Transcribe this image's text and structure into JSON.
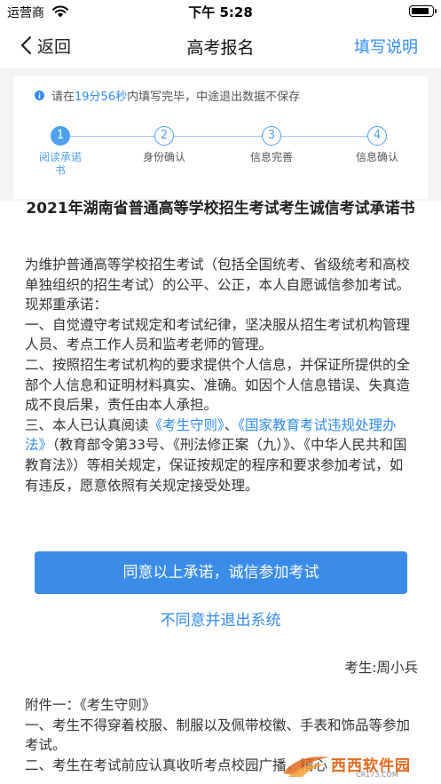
{
  "status_bar": {
    "carrier": "运营商",
    "time": "下午 5:28",
    "battery_level": 0.9
  },
  "nav": {
    "back_label": "返回",
    "title": "高考报名",
    "right_label": "填写说明"
  },
  "notice": {
    "prefix": "请在",
    "time_left": "19分56秒",
    "suffix": "内填写完毕，中途退出数据不保存"
  },
  "steps": [
    {
      "number": "1",
      "label": "阅读承诺书",
      "active": true
    },
    {
      "number": "2",
      "label": "身份确认",
      "active": false
    },
    {
      "number": "3",
      "label": "信息完善",
      "active": false
    },
    {
      "number": "4",
      "label": "信息确认",
      "active": false
    }
  ],
  "document": {
    "title": "2021年湖南省普通高等学校招生考试考生诚信考试承诺书",
    "intro": "为维护普通高等学校招生考试（包括全国统考、省级统考和高校单独组织的招生考试）的公平、公正，本人自愿诚信参加考试。现郑重承诺：",
    "item1": "一、自觉遵守考试规定和考试纪律，坚决服从招生考试机构管理人员、考点工作人员和监考老师的管理。",
    "item2": "二、按照招生考试机构的要求提供个人信息，并保证所提供的全部个人信息和证明材料真实、准确。如因个人信息错误、失真造成不良后果，责任由本人承担。",
    "item3_prefix": "三、本人已认真阅读",
    "link1": "《考生守则》",
    "sep": "、",
    "link2": "《国家教育考试违规处理办法》",
    "item3_suffix": "（教育部令第33号、《刑法修正案（九）》、《中华人民共和国教育法》）等相关规定，保证按规定的程序和要求参加考试，如有违反，愿意依照有关规定接受处理。"
  },
  "actions": {
    "agree_label": "同意以上承诺，诚信参加考试",
    "disagree_label": "不同意并退出系统"
  },
  "signature": "考生:周小兵",
  "appendix": {
    "title": "附件一：《考生守则》",
    "item1": "一、考生不得穿着校服、制服以及佩带校徽、手表和饰品等参加考试。",
    "item2": "二、考生在考试前应认真收听考点校园广播，精心"
  },
  "watermark": {
    "brand": "西西软件园",
    "url": "CR173.COM"
  },
  "colors": {
    "accent": "#2f8cf0",
    "button": "#3b8ce8",
    "step": "#4ca0ee",
    "background": "#f3f3f3"
  }
}
